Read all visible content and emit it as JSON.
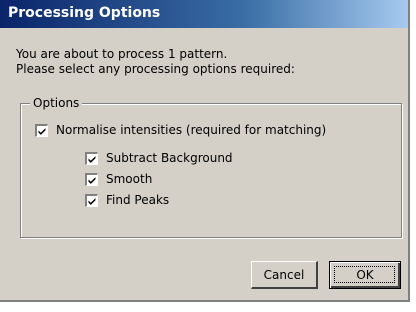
{
  "window": {
    "title": "Processing Options"
  },
  "intro": {
    "line1": "You are about to process 1 pattern.",
    "line2": "Please select any processing options required:"
  },
  "options_group": {
    "label": "Options",
    "normalise": {
      "label": "Normalise intensities (required for matching)",
      "checked": true
    },
    "sub_options": [
      {
        "label": "Subtract Background",
        "checked": true
      },
      {
        "label": "Smooth",
        "checked": true
      },
      {
        "label": "Find Peaks",
        "checked": true
      }
    ]
  },
  "buttons": {
    "cancel_label": "Cancel",
    "ok_label": "OK"
  },
  "colors": {
    "face": "#d4d0c8",
    "title_start": "#0a246a",
    "title_end": "#a6caf0"
  }
}
